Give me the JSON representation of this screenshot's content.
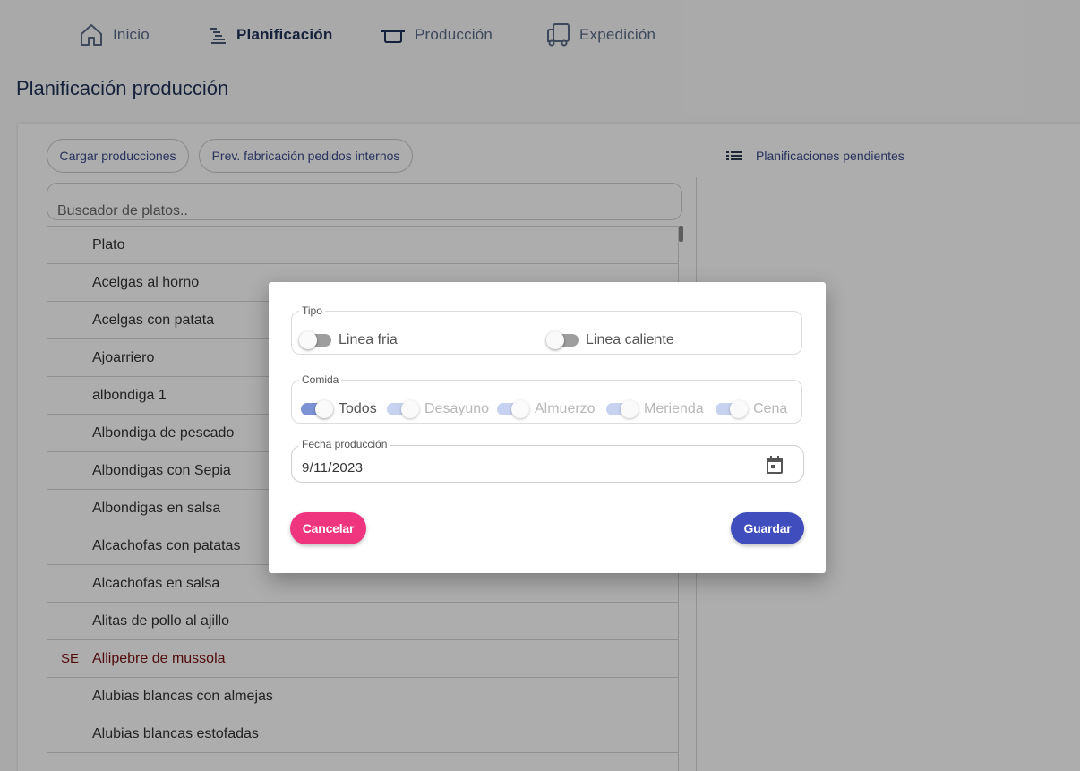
{
  "nav": {
    "items": [
      {
        "label": "Inicio",
        "icon": "home-icon"
      },
      {
        "label": "Planificación",
        "icon": "list-icon",
        "active": true
      },
      {
        "label": "Producción",
        "icon": "pot-icon"
      },
      {
        "label": "Expedición",
        "icon": "truck-icon"
      }
    ]
  },
  "page": {
    "title": "Planificación producción"
  },
  "toolbar": {
    "load_button": "Cargar producciones",
    "preview_button": "Prev. fabricación pedidos internos",
    "pending_label": "Planificaciones pendientes"
  },
  "search": {
    "placeholder": "Buscador de platos.."
  },
  "table": {
    "header": "Plato",
    "rows": [
      {
        "tag": "",
        "name": "Acelgas al horno"
      },
      {
        "tag": "",
        "name": "Acelgas con patata"
      },
      {
        "tag": "",
        "name": "Ajoarriero"
      },
      {
        "tag": "",
        "name": "albondiga 1"
      },
      {
        "tag": "",
        "name": "Albondiga de pescado"
      },
      {
        "tag": "",
        "name": "Albondigas con Sepia"
      },
      {
        "tag": "",
        "name": "Albondigas en salsa"
      },
      {
        "tag": "",
        "name": "Alcachofas con patatas"
      },
      {
        "tag": "",
        "name": "Alcachofas en salsa"
      },
      {
        "tag": "",
        "name": "Alitas de pollo al ajillo"
      },
      {
        "tag": "SE",
        "name": "Allipebre de mussola"
      },
      {
        "tag": "",
        "name": "Alubias blancas con almejas"
      },
      {
        "tag": "",
        "name": "Alubias blancas estofadas"
      }
    ]
  },
  "modal": {
    "tipo": {
      "legend": "Tipo",
      "options": [
        {
          "label": "Linea fria",
          "checked": false
        },
        {
          "label": "Linea caliente",
          "checked": false
        }
      ]
    },
    "comida": {
      "legend": "Comida",
      "options": [
        {
          "label": "Todos",
          "checked": true,
          "enabled": true
        },
        {
          "label": "Desayuno",
          "checked": true,
          "enabled": false
        },
        {
          "label": "Almuerzo",
          "checked": true,
          "enabled": false
        },
        {
          "label": "Merienda",
          "checked": true,
          "enabled": false
        },
        {
          "label": "Cena",
          "checked": true,
          "enabled": false
        }
      ]
    },
    "fecha": {
      "label": "Fecha producción",
      "value": "9/11/2023"
    },
    "cancel_button": "Cancelar",
    "save_button": "Guardar"
  },
  "colors": {
    "cancel": "#f0357f",
    "save": "#3f4dbd",
    "nav_active": "#1f3158",
    "link": "#3b4a8a"
  }
}
